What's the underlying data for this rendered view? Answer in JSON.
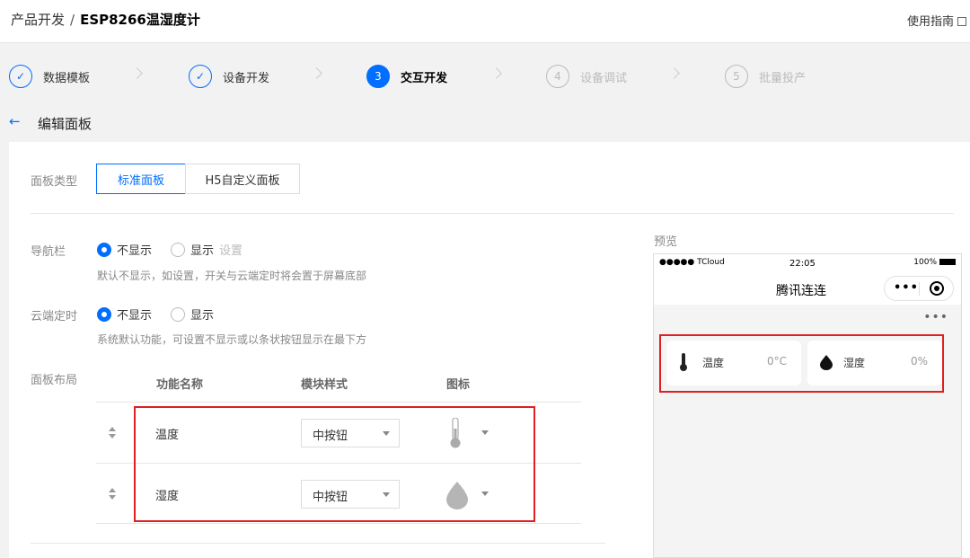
{
  "header": {
    "breadcrumb_parent": "产品开发",
    "breadcrumb_sep": "/",
    "breadcrumb_current": "ESP8266温湿度计",
    "guide_link": "使用指南"
  },
  "steps": [
    {
      "num": "✓",
      "label": "数据模板",
      "state": "done"
    },
    {
      "num": "✓",
      "label": "设备开发",
      "state": "done"
    },
    {
      "num": "3",
      "label": "交互开发",
      "state": "active"
    },
    {
      "num": "4",
      "label": "设备调试",
      "state": "todo"
    },
    {
      "num": "5",
      "label": "批量投产",
      "state": "todo"
    }
  ],
  "page": {
    "back_icon": "←",
    "title": "编辑面板"
  },
  "panel_type": {
    "label": "面板类型",
    "options": [
      "标准面板",
      "H5自定义面板"
    ],
    "selected": "标准面板"
  },
  "navbar": {
    "label": "导航栏",
    "option_hide": "不显示",
    "option_show": "显示",
    "set_link": "设置",
    "hint": "默认不显示，如设置，开关与云端定时将会置于屏幕底部"
  },
  "cloud_timer": {
    "label": "云端定时",
    "option_hide": "不显示",
    "option_show": "显示",
    "hint": "系统默认功能，可设置不显示或以条状按钮显示在最下方"
  },
  "layout": {
    "label": "面板布局",
    "columns": [
      "功能名称",
      "模块样式",
      "图标"
    ],
    "rows": [
      {
        "name": "温度",
        "style": "中按钮",
        "icon": "thermometer-icon"
      },
      {
        "name": "湿度",
        "style": "中按钮",
        "icon": "droplet-icon"
      }
    ]
  },
  "preview": {
    "label": "预览",
    "carrier": "●●●●● TCloud",
    "time": "22:05",
    "battery": "100%",
    "app_title": "腾讯连连",
    "capsule_more": "•••",
    "page_more": "•••",
    "tiles": [
      {
        "name": "温度",
        "value": "0°C",
        "icon": "thermometer-icon"
      },
      {
        "name": "湿度",
        "value": "0%",
        "icon": "droplet-icon"
      }
    ]
  },
  "colors": {
    "accent": "#006eff",
    "highlight_box": "#e02020"
  }
}
